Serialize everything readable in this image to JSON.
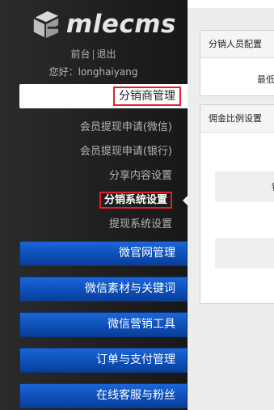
{
  "brand": {
    "name": "mlecms"
  },
  "top_links": {
    "frontend": "前台",
    "separator": "|",
    "logout": "退出"
  },
  "greeting": "您好：longhaiyang",
  "section": {
    "title": "分销商管理"
  },
  "submenu": [
    {
      "label": "会员提现申请(微信)",
      "active": false
    },
    {
      "label": "会员提现申请(银行)",
      "active": false
    },
    {
      "label": "分享内容设置",
      "active": false
    },
    {
      "label": "分销系统设置",
      "active": true
    },
    {
      "label": "提现系统设置",
      "active": false
    }
  ],
  "nav_buttons": [
    {
      "label": "微官网管理"
    },
    {
      "label": "微信素材与关键词"
    },
    {
      "label": "微信营销工具"
    },
    {
      "label": "订单与支付管理"
    },
    {
      "label": "在线客服与粉丝"
    }
  ],
  "main": {
    "panel1": {
      "title": "分销人员配置",
      "body_text": "最低"
    },
    "panel2": {
      "title": "佣金比例设置",
      "row1_text": "钞"
    }
  },
  "colors": {
    "highlight_border": "#e0202a",
    "nav_blue": "#0d4fb8",
    "sidebar_bg": "#222222"
  }
}
